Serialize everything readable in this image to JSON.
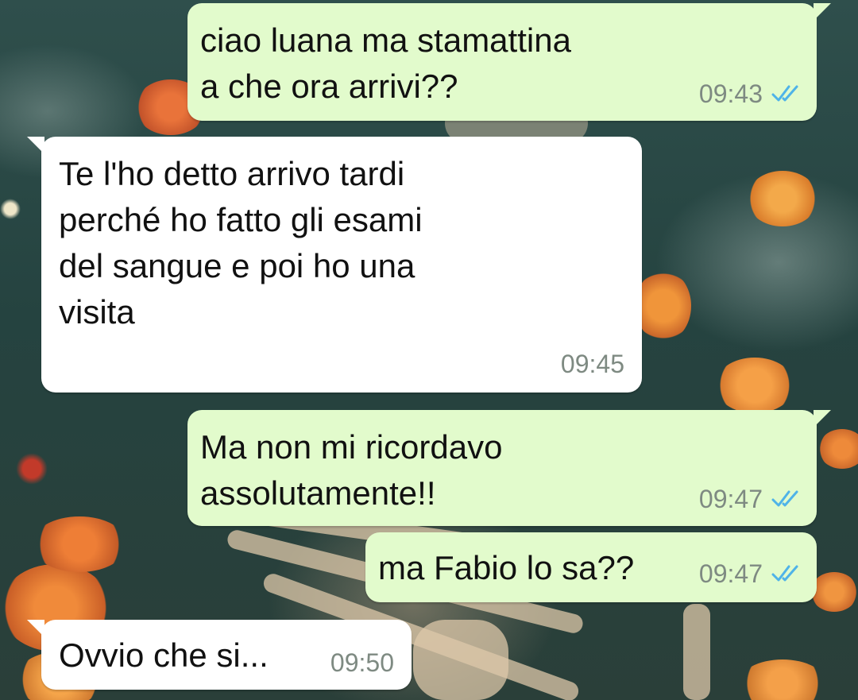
{
  "chat": {
    "messages": [
      {
        "direction": "outgoing",
        "text": "ciao luana ma stamattina\na che ora arrivi??",
        "time": "09:43",
        "status": "read"
      },
      {
        "direction": "incoming",
        "text": "Te l'ho detto arrivo tardi\nperché ho fatto gli esami\ndel sangue e poi ho una\nvisita",
        "time": "09:45"
      },
      {
        "direction": "outgoing",
        "text": "Ma non mi ricordavo\nassolutamente!!",
        "time": "09:47",
        "status": "read"
      },
      {
        "direction": "outgoing",
        "text": "ma Fabio lo sa??",
        "time": "09:47",
        "status": "read"
      },
      {
        "direction": "incoming",
        "text": "Ovvio che si...",
        "time": "09:50"
      }
    ]
  },
  "colors": {
    "outgoing_bubble": "#e2fbcc",
    "incoming_bubble": "#ffffff",
    "read_ticks": "#4fb3e8",
    "timestamp": "#7e8a82"
  },
  "icons": {
    "read_receipt": "double-check-icon"
  }
}
